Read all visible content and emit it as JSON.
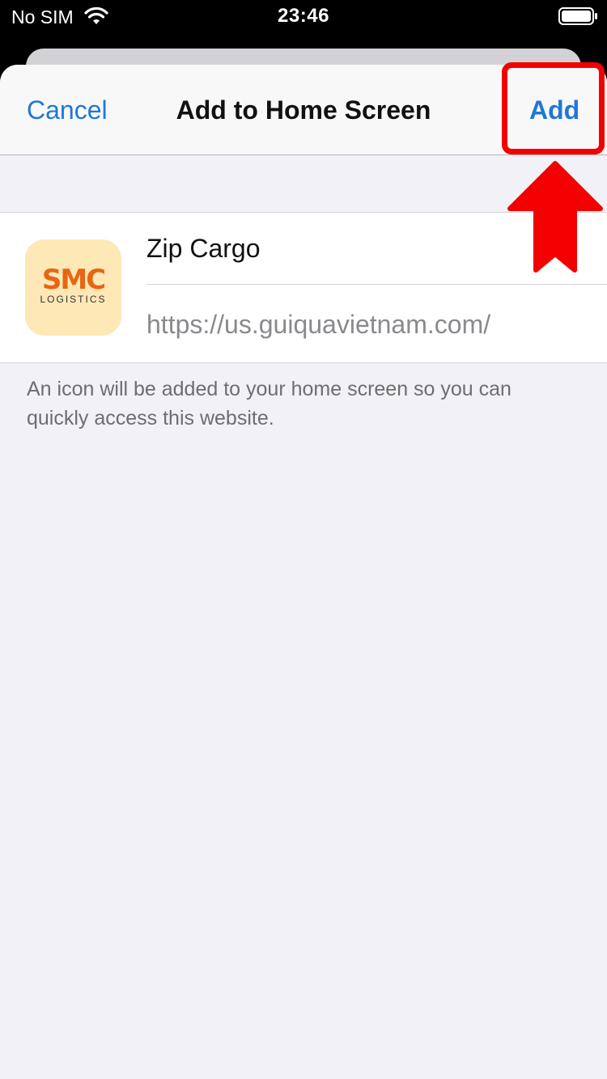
{
  "status_bar": {
    "carrier": "No SIM",
    "time": "23:46"
  },
  "nav": {
    "cancel_label": "Cancel",
    "title": "Add to Home Screen",
    "add_label": "Add"
  },
  "shortcut": {
    "name": "Zip Cargo",
    "url": "https://us.guiquavietnam.com/",
    "icon": {
      "logo_text": "SMC",
      "logo_subtext": "LOGISTICS",
      "background": "#fde8b6",
      "logo_color": "#e86514"
    }
  },
  "footnote": "An icon will be added to your home screen so you can quickly access this website.",
  "colors": {
    "accent": "#1e78d6",
    "annotation": "#f30000"
  }
}
